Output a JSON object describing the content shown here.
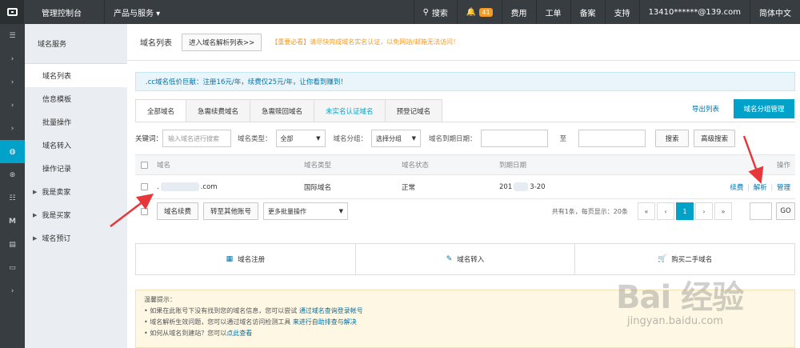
{
  "topbar": {
    "title": "管理控制台",
    "products": "产品与服务 ▾",
    "search": "搜索",
    "bell_count": "41",
    "fees": "费用",
    "tickets": "工单",
    "beian": "备案",
    "support": "支持",
    "account": "13410******@139.com",
    "lang": "简体中文"
  },
  "sidebar_dark": {
    "icons": [
      "menu-icon",
      "chevron-right-icon",
      "chevron-right-icon",
      "chevron-right-icon",
      "chevron-right-icon",
      "globe-icon",
      "www-icon",
      "server-icon",
      "m-icon",
      "list-icon",
      "console-icon",
      "chevron-right-icon"
    ]
  },
  "sidebar": {
    "header": "域名服务",
    "items": [
      {
        "label": "域名列表",
        "expand": ""
      },
      {
        "label": "信息模板",
        "expand": ""
      },
      {
        "label": "批量操作",
        "expand": ""
      },
      {
        "label": "域名转入",
        "expand": ""
      },
      {
        "label": "操作记录",
        "expand": ""
      },
      {
        "label": "我是卖家",
        "expand": "▶"
      },
      {
        "label": "我是买家",
        "expand": "▶"
      },
      {
        "label": "域名预订",
        "expand": "▶"
      }
    ]
  },
  "crumb": {
    "title": "域名列表",
    "dns_button": "进入域名解析列表>>",
    "warning": "【重要必看】请尽快完成域名实名认证，以免网站/邮箱无法访问！"
  },
  "notice": ".cc域名低价巨献：注册16元/年，续费仅25元/年，让你看到赚到！",
  "tabs": [
    "全部域名",
    "急需续费域名",
    "急需赎回域名",
    "未实名认证域名",
    "预登记域名"
  ],
  "export": "导出列表",
  "group_manage": "域名分组管理",
  "filter": {
    "keyword_label": "关键词：",
    "keyword_placeholder": "输入域名进行搜索",
    "type_label": "域名类型：",
    "type_value": "全部",
    "group_label": "域名分组：",
    "group_value": "选择分组",
    "expire_label": "域名到期日期：",
    "to": "至",
    "search": "搜索",
    "advanced": "高级搜索"
  },
  "table": {
    "headers": [
      "域名",
      "域名类型",
      "域名状态",
      "到期日期",
      "操作"
    ],
    "row": {
      "domain_prefix": ".",
      "domain_suffix": ".com",
      "type": "国际域名",
      "status": "正常",
      "date_prefix": "201",
      "date_suffix": "3-20",
      "renew": "续费",
      "sep1": "|",
      "resolve": "解析",
      "sep2": "|",
      "manage": "管理"
    },
    "footer": {
      "renew": "域名续费",
      "transfer": "转至其他账号",
      "batch": "更多批量操作",
      "summary": "共有1条，每页显示：20条",
      "pages": [
        "«",
        "‹",
        "1",
        "›",
        "»"
      ],
      "go": "GO"
    }
  },
  "actions": [
    {
      "icon": "calendar-icon",
      "glyph": "▦",
      "label": "域名注册"
    },
    {
      "icon": "pencil-icon",
      "glyph": "✎",
      "label": "域名转入"
    },
    {
      "icon": "cart-icon",
      "glyph": "🛒",
      "label": "购买二手域名"
    }
  ],
  "tips": {
    "title": "温馨提示：",
    "lines": [
      {
        "text": "• 如果在此账号下没有找到您的域名信息，您可以尝试 ",
        "link": "通过域名查询登录帐号",
        "text2": ""
      },
      {
        "text": "• 域名解析生效问题，您可以通过域名访问检测工具 ",
        "link": "来进行自助排查与解决",
        "text2": ""
      },
      {
        "text": "• 如何从域名到建站？您可以",
        "link": "点此查看",
        "text2": ""
      }
    ]
  },
  "watermark": {
    "big": "Bai 经验",
    "small": "jingyan.baidu.com"
  },
  "colors": {
    "accent": "#00a2ca",
    "topbar": "#373d41",
    "arrow": "#e8373a"
  }
}
